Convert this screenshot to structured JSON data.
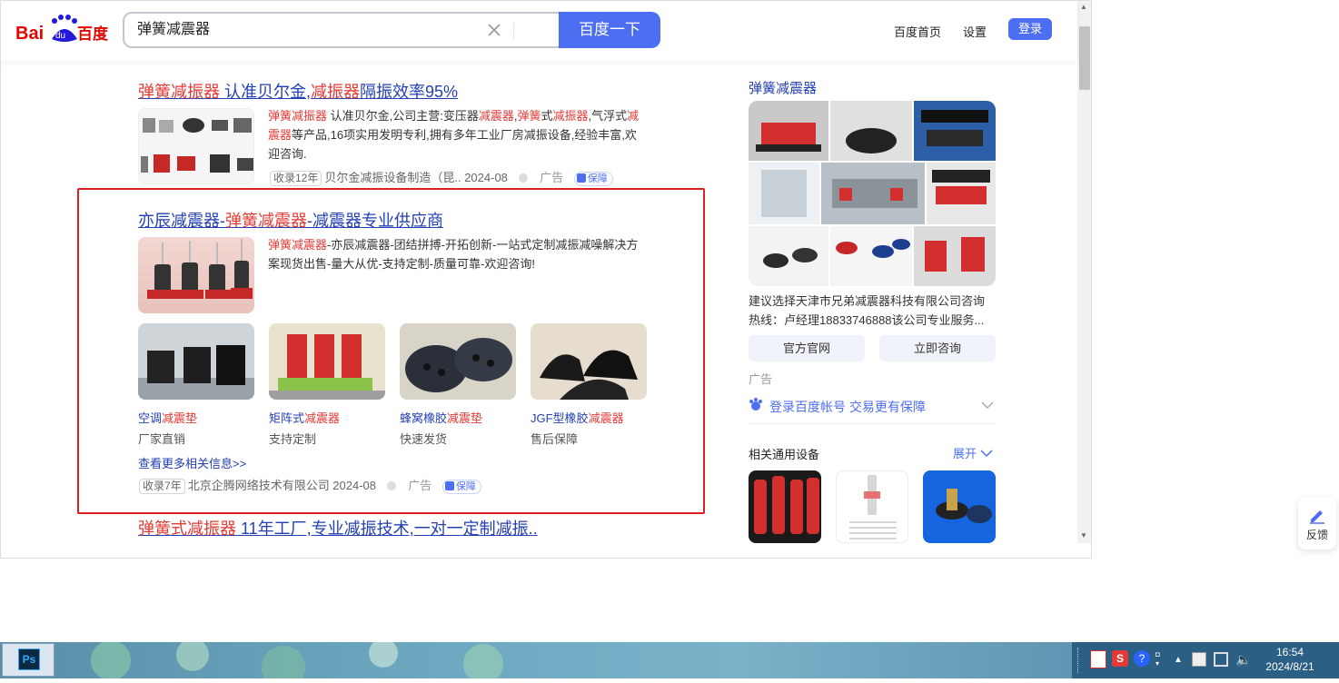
{
  "search": {
    "query": "弹簧减震器",
    "button": "百度一下"
  },
  "header": {
    "home": "百度首页",
    "settings": "设置",
    "login": "登录"
  },
  "results": [
    {
      "title_parts": [
        [
          "弹簧减振器",
          true
        ],
        [
          " 认准贝尔金,",
          false
        ],
        [
          "减振器",
          true
        ],
        [
          "隔振效率95%",
          false
        ]
      ],
      "desc_parts": [
        [
          "弹簧减振器",
          true
        ],
        [
          " 认准贝尔金,公司主营:变压器",
          false
        ],
        [
          "减震器",
          true
        ],
        [
          ",",
          false
        ],
        [
          "弹簧",
          true
        ],
        [
          "式",
          false
        ],
        [
          "减振器",
          true
        ],
        [
          ",气浮式",
          false
        ],
        [
          "减震器",
          true
        ],
        [
          "等产品,16项实用发明专利,拥有多年工业厂房减振设备,经验丰富,欢迎咨询.",
          false
        ]
      ],
      "tag": "收录12年",
      "source": "贝尔金减振设备制造（昆.. 2024-08",
      "ad": "广告",
      "guarantee": "保障"
    },
    {
      "title_parts": [
        [
          "亦辰减震器-",
          false
        ],
        [
          "弹簧减震器",
          true
        ],
        [
          "-减震器专业供应商",
          false
        ]
      ],
      "desc_parts": [
        [
          "弹簧减震器",
          true
        ],
        [
          "-亦辰减震器-团结拼搏-开拓创新-一站式定制减振减噪解决方案现货出售-量大从优-支持定制-质量可靠-欢迎咨询!",
          false
        ]
      ],
      "products": [
        {
          "cap_parts": [
            [
              "空调",
              false
            ],
            [
              "减震垫",
              true
            ]
          ],
          "sub": "厂家直销"
        },
        {
          "cap_parts": [
            [
              "矩阵式",
              false
            ],
            [
              "减震器",
              true
            ]
          ],
          "sub": "支持定制"
        },
        {
          "cap_parts": [
            [
              "蜂窝橡胶",
              false
            ],
            [
              "减震垫",
              true
            ]
          ],
          "sub": "快速发货"
        },
        {
          "cap_parts": [
            [
              "JGF型橡胶",
              false
            ],
            [
              "减震器",
              true
            ]
          ],
          "sub": "售后保障"
        }
      ],
      "more": "查看更多相关信息>>",
      "tag": "收录7年",
      "source": "北京企腾网络技术有限公司 2024-08",
      "ad": "广告",
      "guarantee": "保障"
    },
    {
      "title_parts": [
        [
          "弹簧式",
          true
        ],
        [
          "减振器",
          true
        ],
        [
          " 11年工厂,专业减振技术,一对一定制减振..",
          false
        ]
      ]
    }
  ],
  "side": {
    "title": "弹簧减震器",
    "desc": "建议选择天津市兄弟减震器科技有限公司咨询热线：卢经理18833746888该公司专业服务...",
    "btn1": "官方官网",
    "btn2": "立即咨询",
    "ad": "广告",
    "login_note": "登录百度帐号 交易更有保障",
    "related": "相关通用设备",
    "expand": "展开"
  },
  "feedback": "反馈",
  "clock": {
    "time": "16:54",
    "date": "2024/8/21"
  },
  "colors": {
    "accent": "#4e6ef2",
    "link": "#2440b3",
    "highlight": "#e53935",
    "box": "#e02020"
  }
}
